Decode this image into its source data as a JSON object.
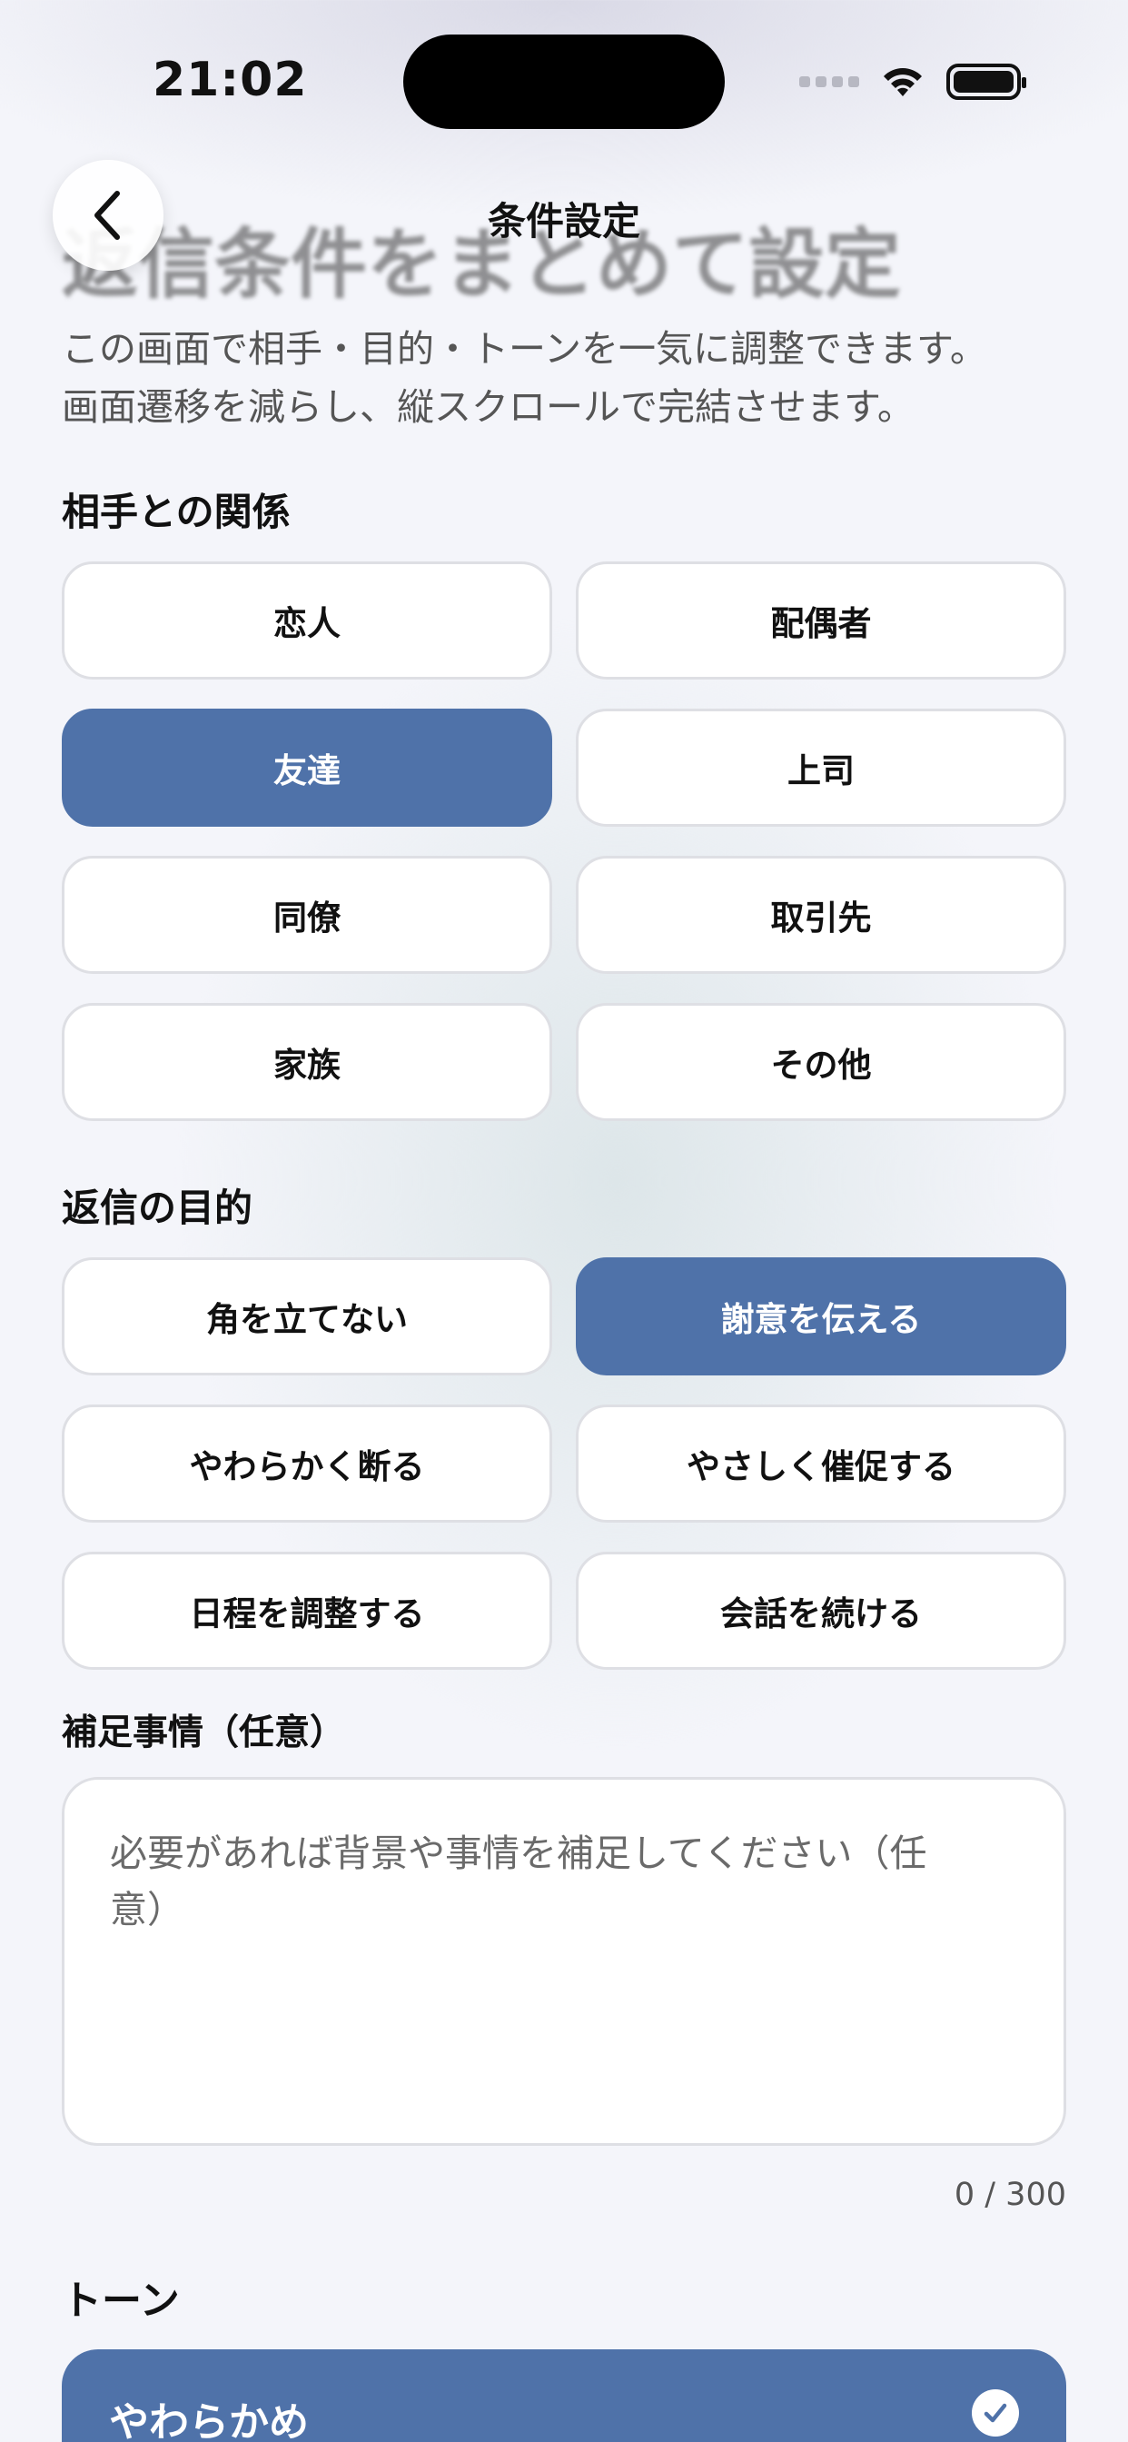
{
  "status_bar": {
    "time": "21:02"
  },
  "nav": {
    "title": "条件設定",
    "back_icon": "chevron-left-icon"
  },
  "ghost_heading": "返信条件をまとめて設定",
  "intro": {
    "line1": "この画面で相手・目的・トーンを一気に調整できます。",
    "line2": "画面遷移を減らし、縦スクロールで完結させます。"
  },
  "relationship": {
    "label": "相手との関係",
    "options": [
      {
        "label": "恋人",
        "selected": false
      },
      {
        "label": "配偶者",
        "selected": false
      },
      {
        "label": "友達",
        "selected": true
      },
      {
        "label": "上司",
        "selected": false
      },
      {
        "label": "同僚",
        "selected": false
      },
      {
        "label": "取引先",
        "selected": false
      },
      {
        "label": "家族",
        "selected": false
      },
      {
        "label": "その他",
        "selected": false
      }
    ]
  },
  "purpose": {
    "label": "返信の目的",
    "options": [
      {
        "label": "角を立てない",
        "selected": false
      },
      {
        "label": "謝意を伝える",
        "selected": true
      },
      {
        "label": "やわらかく断る",
        "selected": false
      },
      {
        "label": "やさしく催促する",
        "selected": false
      },
      {
        "label": "日程を調整する",
        "selected": false
      },
      {
        "label": "会話を続ける",
        "selected": false
      }
    ]
  },
  "notes": {
    "label": "補足事情（任意）",
    "placeholder": "必要があれば背景や事情を補足してください（任意）",
    "value": "",
    "counter": "0 / 300"
  },
  "tone": {
    "label": "トーン",
    "options": [
      {
        "label": "やわらかめ",
        "selected": true
      }
    ]
  },
  "colors": {
    "accent": "#4f72a9",
    "background": "#f4f5fa",
    "chip_border": "#dedfe4"
  }
}
